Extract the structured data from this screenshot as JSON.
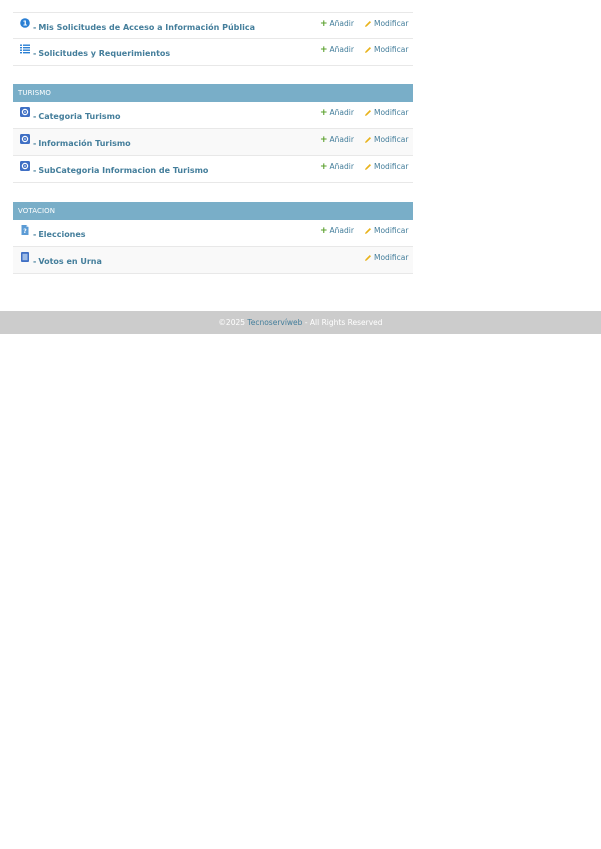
{
  "colors": {
    "caption_bg": "#79aec8",
    "link": "#447e9b",
    "add_icon": "#5aa02c",
    "edit_icon": "#e8b21a",
    "footer_bg": "#cccccc"
  },
  "actions": {
    "add_label": "Añadir",
    "modify_label": "Modificar"
  },
  "modules": [
    {
      "caption": "",
      "rows": [
        {
          "icon": "info-circle-icon",
          "dash": "-",
          "label": "Mis Solicitudes de Acceso a Información Pública",
          "has_add": true,
          "has_modify": true
        },
        {
          "icon": "list-icon",
          "dash": "-",
          "label": "Solicitudes y Requerimientos",
          "has_add": true,
          "has_modify": true
        }
      ]
    },
    {
      "caption": "TURISMO",
      "rows": [
        {
          "icon": "gear-square-icon",
          "dash": "-",
          "label": "Categoria Turismo",
          "has_add": true,
          "has_modify": true
        },
        {
          "icon": "gear-square-icon",
          "dash": "-",
          "label": "Información Turismo",
          "has_add": true,
          "has_modify": true
        },
        {
          "icon": "gear-square-icon",
          "dash": "-",
          "label": "SubCategoria Informacion de Turismo",
          "has_add": true,
          "has_modify": true
        }
      ]
    },
    {
      "caption": "VOTACION",
      "rows": [
        {
          "icon": "document-question-icon",
          "dash": "-",
          "label": "Elecciones",
          "has_add": true,
          "has_modify": true
        },
        {
          "icon": "ballot-box-icon",
          "dash": "-",
          "label": "Votos en Urna",
          "has_add": false,
          "has_modify": true
        }
      ]
    }
  ],
  "footer": {
    "year": "©2025",
    "brand": "Tecnoservíweb",
    "rights": "- All Rights Reserved"
  }
}
